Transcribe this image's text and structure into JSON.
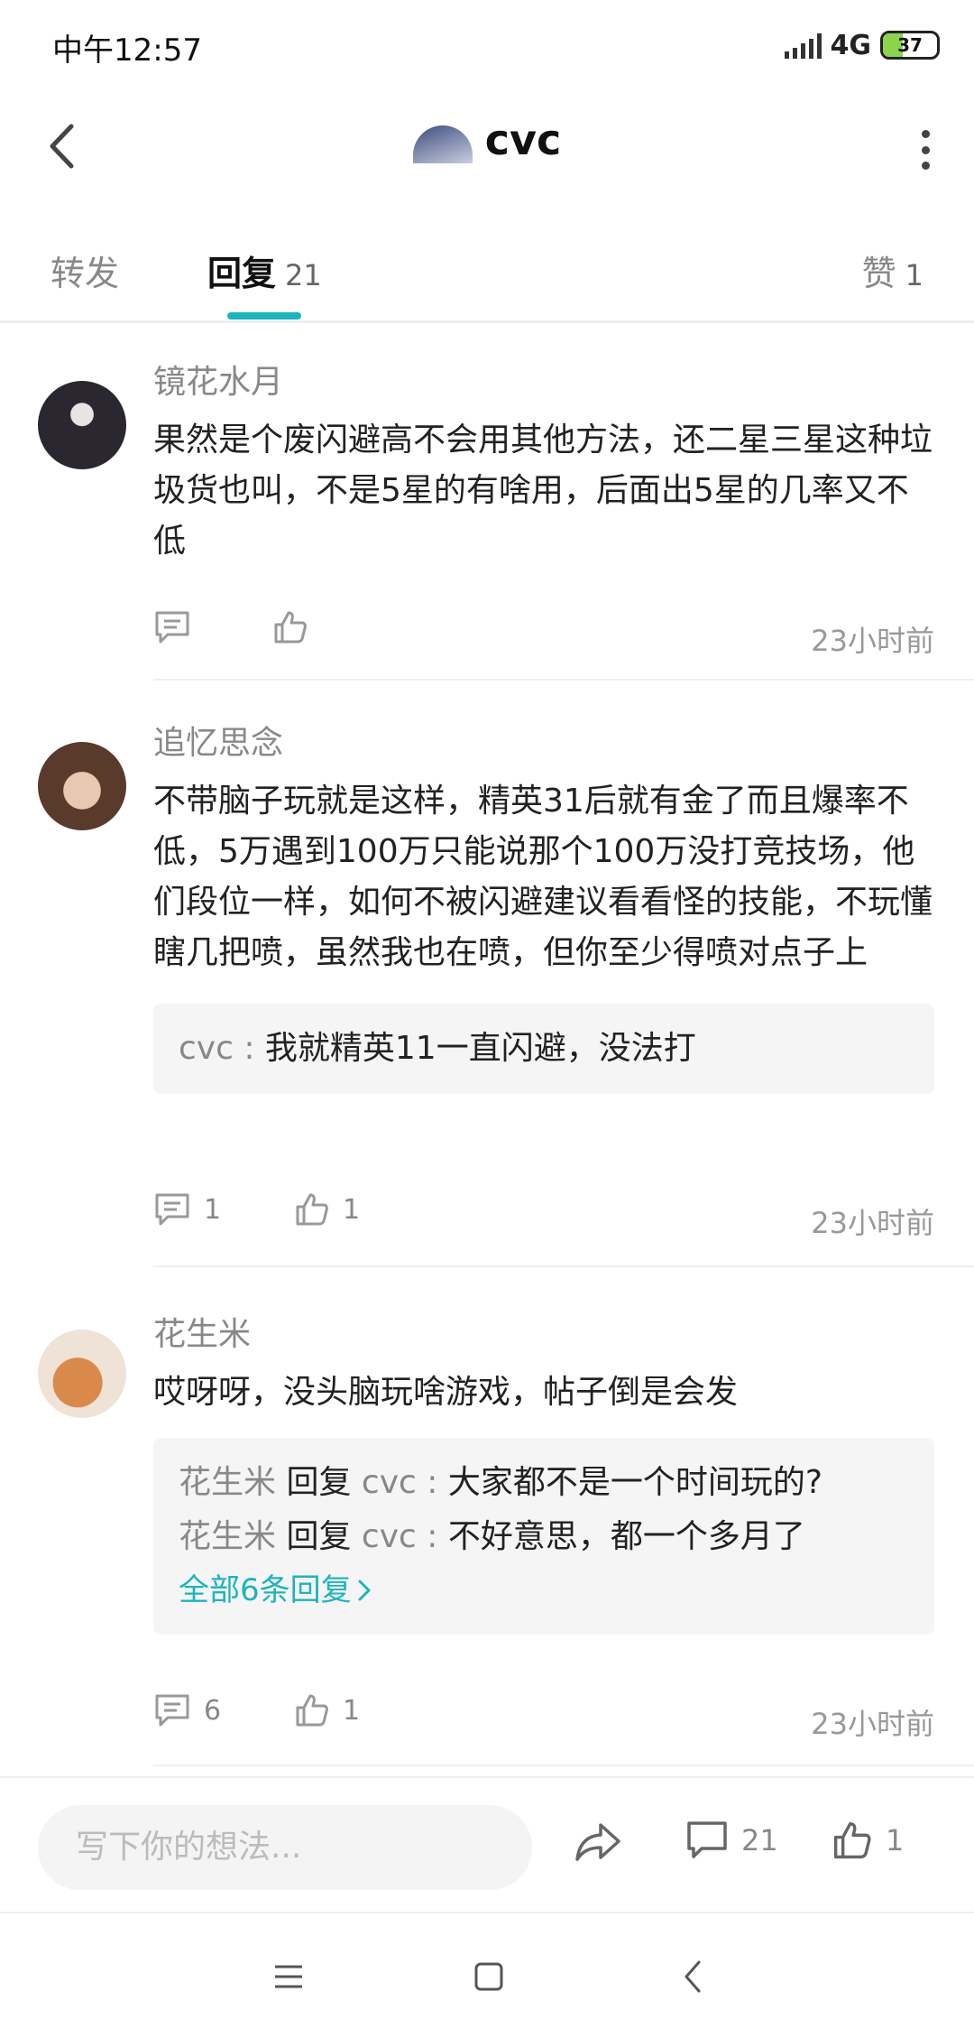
{
  "status_bar": {
    "time": "中午12:57",
    "network": "4G",
    "battery": "37",
    "battery_level": 0.37
  },
  "header": {
    "title": "cvc"
  },
  "tabs": [
    {
      "label": "转发",
      "count": ""
    },
    {
      "label": "回复",
      "count": "21"
    },
    {
      "label": "赞",
      "count": "1"
    }
  ],
  "comments": [
    {
      "user": "镜花水月",
      "text": "果然是个废闪避高不会用其他方法，还二星三星这种垃圾货也叫，不是5星的有啥用，后面出5星的几率又不低",
      "time": "23小时前"
    },
    {
      "user": "追忆思念",
      "text": "不带脑子玩就是这样，精英31后就有金了而且爆率不低，5万遇到100万只能说那个100万没打竞技场，他们段位一样，如何不被闪避建议看看怪的技能，不玩懂瞎几把喷，虽然我也在喷，但你至少得喷对点子上",
      "replies": [
        {
          "user": "cvc",
          "sep": " : ",
          "text": "我就精英11一直闪避，没法打"
        }
      ],
      "reply_count": "1",
      "like_count": "1",
      "time": "23小时前"
    },
    {
      "user": "花生米",
      "text": "哎呀呀，没头脑玩啥游戏，帖子倒是会发",
      "replies": [
        {
          "user": "花生米",
          "verb": " 回复 ",
          "target": "cvc",
          "sep": " : ",
          "text": "大家都不是一个时间玩的?"
        },
        {
          "user": "花生米",
          "verb": " 回复 ",
          "target": "cvc",
          "sep": " : ",
          "text": "不好意思，都一个多月了"
        }
      ],
      "all_replies": "全部6条回复",
      "reply_count": "6",
      "like_count": "1",
      "time": "23小时前"
    }
  ],
  "bottom_bar": {
    "input_placeholder": "写下你的想法...",
    "comment_count": "21",
    "like_count": "1"
  },
  "colors": {
    "accent": "#1cb4bd",
    "muted": "#888888",
    "reply_bg": "#f5f5f5"
  }
}
